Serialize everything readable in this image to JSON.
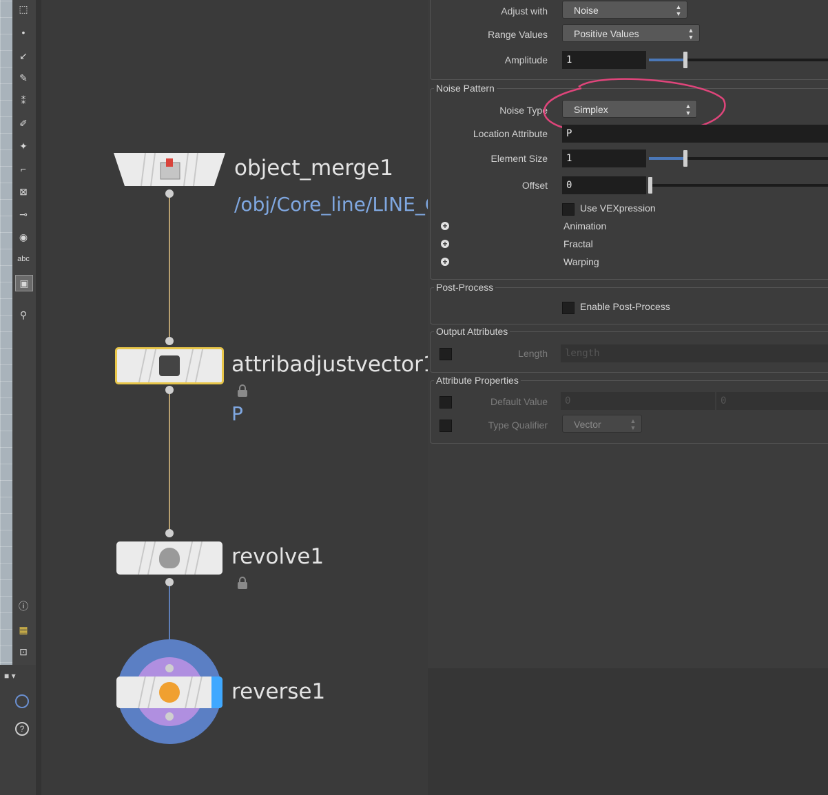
{
  "toolbar": {
    "text_tool_label": "abc"
  },
  "network": {
    "nodes": [
      {
        "name": "object_merge1",
        "sub": "/obj/Core_line/LINE_C"
      },
      {
        "name": "attribadjustvector1",
        "sub": "P"
      },
      {
        "name": "revolve1"
      },
      {
        "name": "reverse1"
      }
    ]
  },
  "params": {
    "adjust_with": {
      "label": "Adjust with",
      "value": "Noise"
    },
    "range_values": {
      "label": "Range Values",
      "value": "Positive Values"
    },
    "amplitude": {
      "label": "Amplitude",
      "value": "1"
    },
    "noise_pattern": {
      "title": "Noise Pattern",
      "noise_type": {
        "label": "Noise Type",
        "value": "Simplex"
      },
      "location_attribute": {
        "label": "Location Attribute",
        "value": "P"
      },
      "element_size": {
        "label": "Element Size",
        "value": "1"
      },
      "offset": {
        "label": "Offset",
        "value": "0"
      },
      "use_vexpression": "Use VEXpression",
      "folders": [
        "Animation",
        "Fractal",
        "Warping"
      ]
    },
    "post_process": {
      "title": "Post-Process",
      "enable": "Enable Post-Process"
    },
    "output_attributes": {
      "title": "Output Attributes",
      "length_label": "Length",
      "length_placeholder": "length"
    },
    "attribute_properties": {
      "title": "Attribute Properties",
      "default_value_label": "Default Value",
      "default_value": [
        "0",
        "0"
      ],
      "type_qualifier_label": "Type Qualifier",
      "type_qualifier": "Vector"
    }
  },
  "colors": {
    "annotation": "#e0457b",
    "selected_node": "#e8c64a",
    "wire": "#b8a070",
    "param_link": "#7fa7e0"
  }
}
